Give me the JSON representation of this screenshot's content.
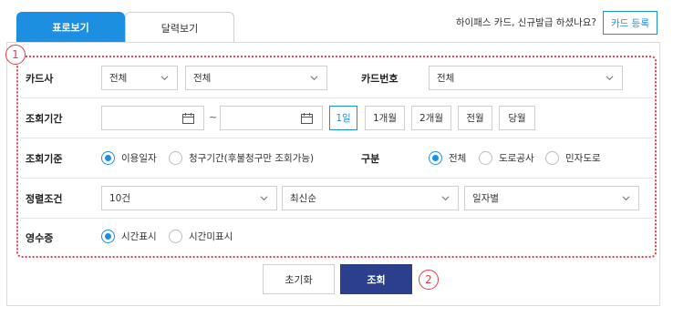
{
  "tabs": [
    {
      "label": "표로보기",
      "active": true
    },
    {
      "label": "달력보기",
      "active": false
    }
  ],
  "promo_text": "하이패스 카드, 신규발급 하셨나요?",
  "card_register_label": "카드 등록",
  "markers": [
    "1",
    "2"
  ],
  "filters": {
    "card_company": {
      "label": "카드사",
      "select1": "전체",
      "select2": "전체"
    },
    "card_number": {
      "label": "카드번호",
      "value": "전체"
    },
    "period": {
      "label": "조회기간",
      "start": "",
      "end": "",
      "separator": "~",
      "quick": [
        {
          "label": "1일",
          "selected": true
        },
        {
          "label": "1개월",
          "selected": false
        },
        {
          "label": "2개월",
          "selected": false
        },
        {
          "label": "전월",
          "selected": false
        },
        {
          "label": "당월",
          "selected": false
        }
      ]
    },
    "basis": {
      "label": "조회기준",
      "options": [
        {
          "label": "이용일자",
          "selected": true
        },
        {
          "label": "청구기간(후불청구만 조회가능)",
          "selected": false
        }
      ]
    },
    "category": {
      "label": "구분",
      "options": [
        {
          "label": "전체",
          "selected": true
        },
        {
          "label": "도로공사",
          "selected": false
        },
        {
          "label": "민자도로",
          "selected": false
        }
      ]
    },
    "sort": {
      "label": "정렬조건",
      "count": "10건",
      "order": "최신순",
      "group": "일자별"
    },
    "receipt": {
      "label": "영수증",
      "options": [
        {
          "label": "시간표시",
          "selected": true
        },
        {
          "label": "시간미표시",
          "selected": false
        }
      ]
    }
  },
  "buttons": {
    "reset": "초기화",
    "search": "조회"
  },
  "colors": {
    "accent": "#1d8fe0",
    "primary_button": "#2b3f8c",
    "marker": "#e23b47"
  }
}
